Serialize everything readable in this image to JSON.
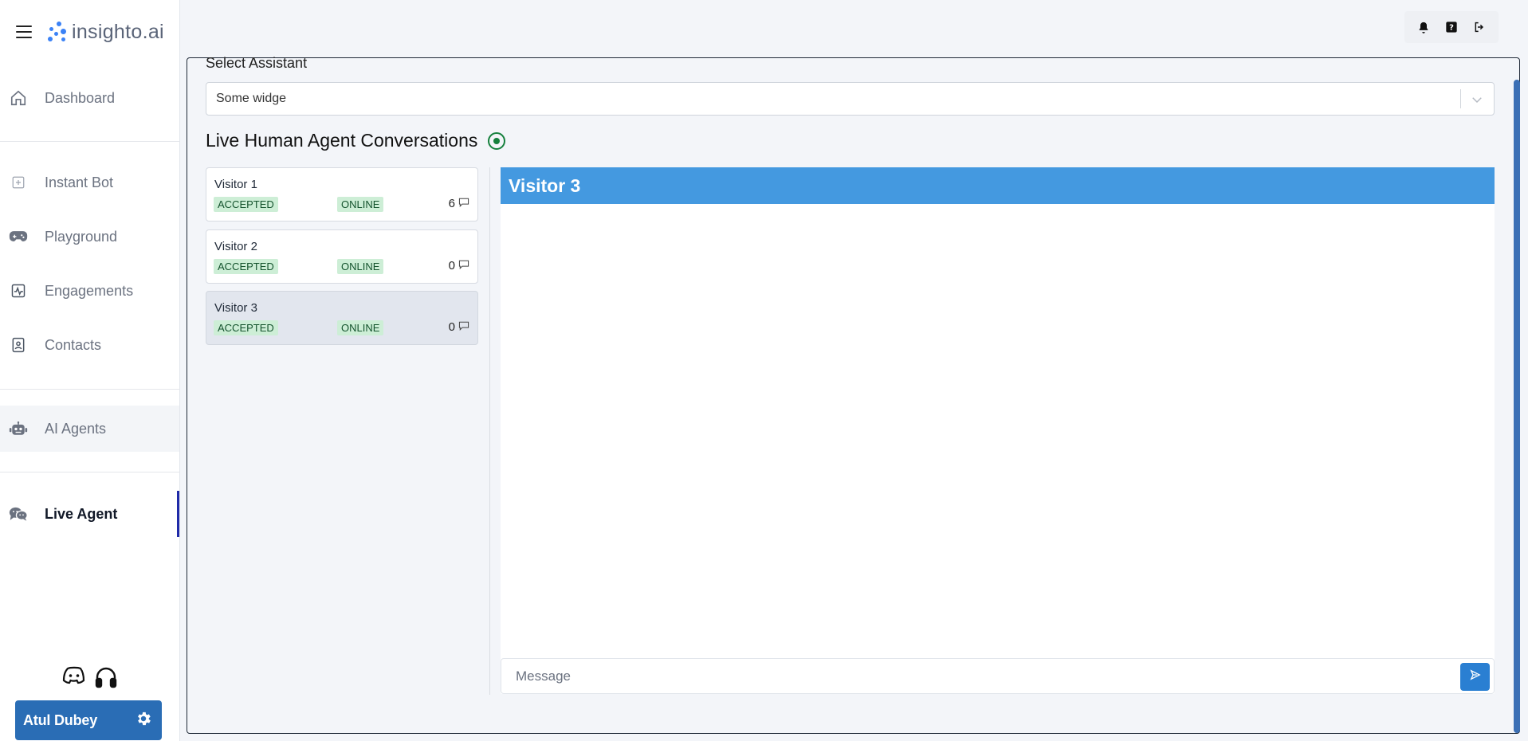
{
  "app": {
    "brand": "insighto.ai"
  },
  "sidebar": {
    "items": [
      {
        "label": "Dashboard",
        "icon": "home-icon"
      },
      {
        "label": "Instant Bot",
        "icon": "plus-square-icon"
      },
      {
        "label": "Playground",
        "icon": "gamepad-icon"
      },
      {
        "label": "Engagements",
        "icon": "activity-chart-icon"
      },
      {
        "label": "Contacts",
        "icon": "contact-card-icon"
      },
      {
        "label": "AI Agents",
        "icon": "robot-icon"
      },
      {
        "label": "Live Agent",
        "icon": "chat-bubbles-icon",
        "active": true
      }
    ],
    "user": {
      "name": "Atul Dubey"
    }
  },
  "topbar": {
    "icons": [
      "bell-icon",
      "help-icon",
      "logout-icon"
    ]
  },
  "main": {
    "select_label": "Select Assistant",
    "select_value": "Some widge",
    "section_title": "Live Human Agent Conversations",
    "visitors": [
      {
        "name": "Visitor 1",
        "status": "ACCEPTED",
        "presence": "ONLINE",
        "messages": "6"
      },
      {
        "name": "Visitor 2",
        "status": "ACCEPTED",
        "presence": "ONLINE",
        "messages": "0"
      },
      {
        "name": "Visitor 3",
        "status": "ACCEPTED",
        "presence": "ONLINE",
        "messages": "0",
        "selected": true
      }
    ],
    "chat": {
      "title": "Visitor 3",
      "input_placeholder": "Message"
    }
  },
  "colors": {
    "accent": "#2a6db5",
    "chat_header": "#4499e0",
    "badge_bg": "#cdeed6",
    "live_indicator": "#15803d",
    "active_marker": "#1f2aa8"
  }
}
